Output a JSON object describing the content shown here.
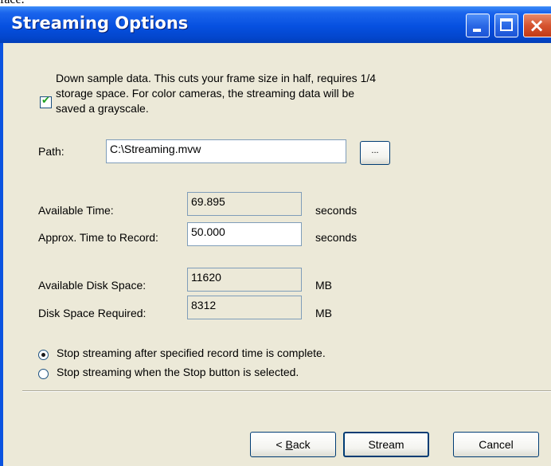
{
  "page_caption_fragment": "face.",
  "window": {
    "title": "Streaming Options",
    "controls": {
      "minimize": "minimize",
      "maximize": "maximize",
      "close": "×"
    }
  },
  "downsample": {
    "checked": true,
    "check_glyph": "✔",
    "lines": [
      "Down sample data.  This cuts your frame size in half, requires 1/4",
      "storage space.  For color cameras, the streaming data will be",
      "saved a grayscale."
    ]
  },
  "path": {
    "label": "Path:",
    "value": "C:\\Streaming.mvw",
    "browse_label": "..."
  },
  "time": {
    "available_label": "Available Time:",
    "available_value": "69.895",
    "available_unit": "seconds",
    "record_label": "Approx. Time to Record:",
    "record_value": "50.000",
    "record_unit": "seconds"
  },
  "disk": {
    "available_label": "Available Disk Space:",
    "available_value": "11620",
    "available_unit": "MB",
    "required_label": "Disk Space Required:",
    "required_value": "8312",
    "required_unit": "MB"
  },
  "stop_mode": {
    "selected": 0,
    "options": [
      "Stop streaming after specified record time is complete.",
      "Stop streaming when the Stop button is selected."
    ]
  },
  "buttons": {
    "back_prefix": "< ",
    "back_mnemonic": "B",
    "back_rest": "ack",
    "stream": "Stream",
    "cancel": "Cancel"
  },
  "colors": {
    "titlebar": "#0650e0",
    "dialog_face": "#ece9d8",
    "field_border": "#7f9db9",
    "close_button": "#d65430"
  }
}
